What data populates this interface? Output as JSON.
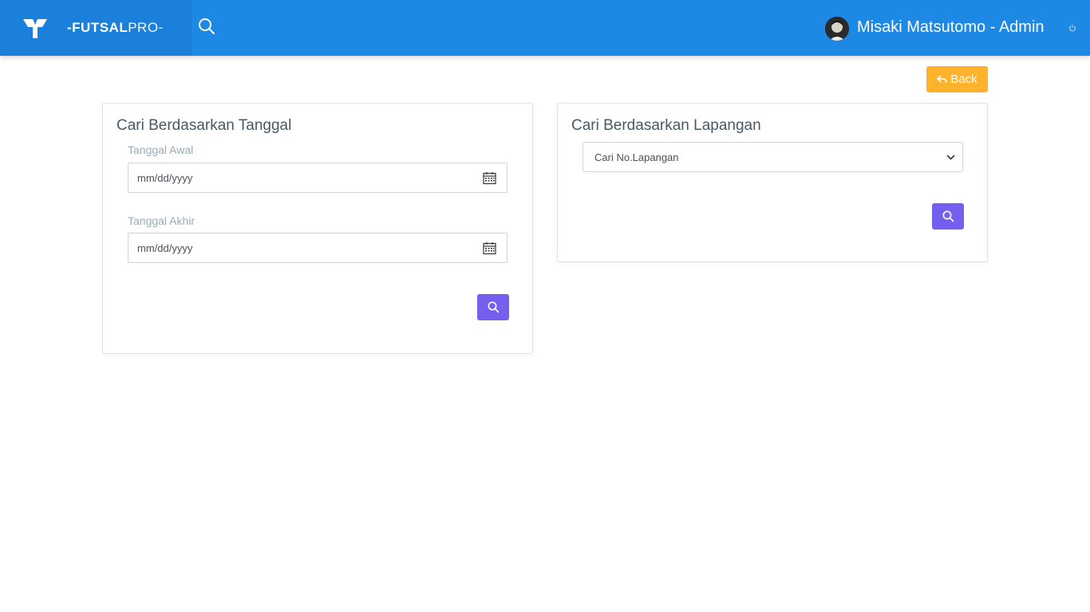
{
  "header": {
    "brand_bold": "-FUTSAL",
    "brand_light": "PRO-",
    "user_name": "Misaki Matsutomo - Admin",
    "icons": [
      "logo-icon",
      "search-icon",
      "avatar",
      "power-icon"
    ]
  },
  "toolbar": {
    "back_label": "Back",
    "back_icon": "undo-icon"
  },
  "date_search": {
    "title": "Cari Berdasarkan Tanggal",
    "start_label": "Tanggal Awal",
    "start_placeholder": "mm/dd/yyyy",
    "end_label": "Tanggal Akhir",
    "end_placeholder": "mm/dd/yyyy",
    "button_icon": "search-icon"
  },
  "field_search": {
    "title": "Cari Berdasarkan Lapangan",
    "select_value": "Cari No.Lapangan",
    "button_icon": "search-icon"
  },
  "colors": {
    "header": "#1e88e5",
    "brand_panel": "#1b80d9",
    "back_button": "#ffb22b",
    "search_button": "#7460ee"
  }
}
